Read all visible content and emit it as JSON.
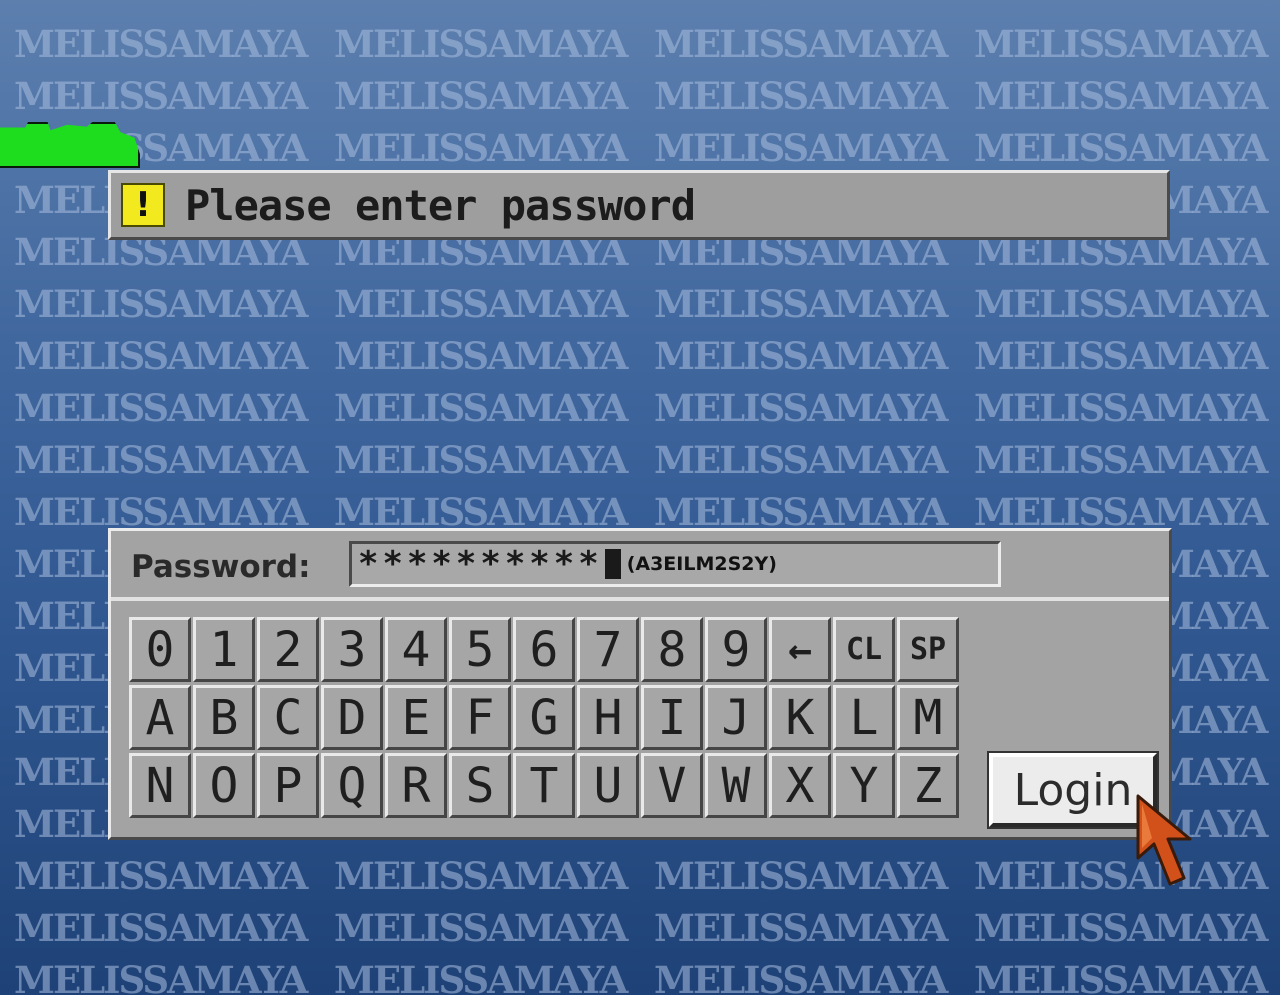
{
  "background": {
    "watermark_text": "MELISSAMAYA",
    "gradient_top": "#5c7fae",
    "gradient_bottom": "#1e4277"
  },
  "logo": {
    "color": "#1edc1e"
  },
  "prompt": {
    "icon_symbol": "!",
    "icon_color": "#f2ea1e",
    "text": "Please enter password"
  },
  "password": {
    "label": "Password:",
    "masked_value": "**********",
    "hint": "(A3EILM2S2Y)"
  },
  "keypad": {
    "keys": [
      "0",
      "1",
      "2",
      "3",
      "4",
      "5",
      "6",
      "7",
      "8",
      "9",
      "←",
      "CL",
      "SP",
      "A",
      "B",
      "C",
      "D",
      "E",
      "F",
      "G",
      "H",
      "I",
      "J",
      "K",
      "L",
      "M",
      "N",
      "O",
      "P",
      "Q",
      "R",
      "S",
      "T",
      "U",
      "V",
      "W",
      "X",
      "Y",
      "Z"
    ]
  },
  "login_button": {
    "label": "Login"
  },
  "cursor": {
    "icon": "mouse-pointer-icon",
    "color": "#d2501a"
  }
}
